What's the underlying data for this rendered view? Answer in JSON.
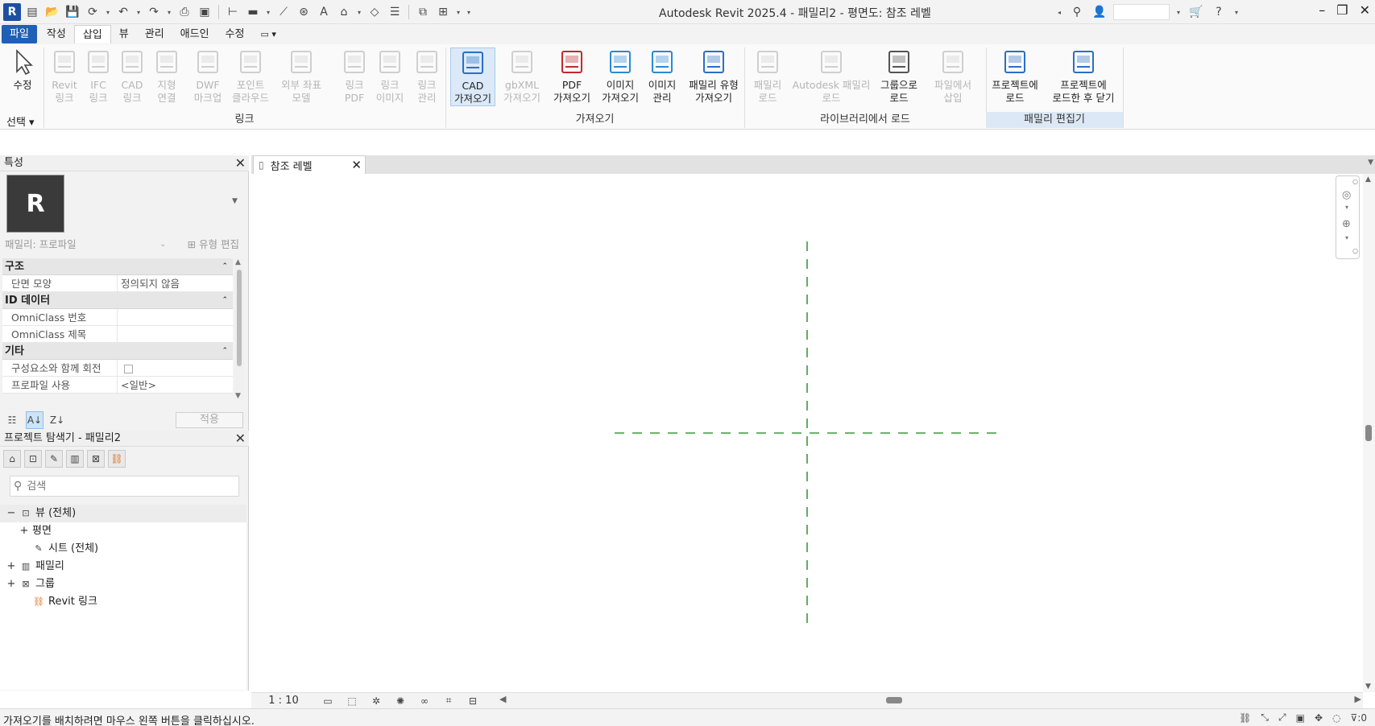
{
  "window": {
    "title": "Autodesk Revit 2025.4 - 패밀리2 - 평면도: 참조 레벨",
    "logo": "R"
  },
  "menu": {
    "tabs": [
      "파일",
      "작성",
      "삽입",
      "뷰",
      "관리",
      "애드인",
      "수정"
    ],
    "active_index": 2
  },
  "ribbon": {
    "select_label": "선택",
    "buttons": [
      {
        "id": "modify",
        "label": "수정",
        "icon": "cursor-arrow-icon",
        "disabled": false
      },
      {
        "id": "revit-link",
        "label": "Revit\n링크",
        "icon": "revit-link-icon",
        "disabled": true
      },
      {
        "id": "ifc-link",
        "label": "IFC\n링크",
        "icon": "ifc-link-icon",
        "disabled": true
      },
      {
        "id": "cad-link",
        "label": "CAD\n링크",
        "icon": "cad-link-icon",
        "disabled": true
      },
      {
        "id": "topo-link",
        "label": "지형\n연결",
        "icon": "topography-icon",
        "disabled": true
      },
      {
        "id": "dwf-markup",
        "label": "DWF\n마크업",
        "icon": "dwf-markup-icon",
        "disabled": true
      },
      {
        "id": "point-cloud",
        "label": "포인트\n클라우드",
        "icon": "point-cloud-icon",
        "disabled": true
      },
      {
        "id": "coord-model",
        "label": "외부 좌표\n모델",
        "icon": "coordination-model-icon",
        "disabled": true
      },
      {
        "id": "link-pdf",
        "label": "링크\nPDF",
        "icon": "link-pdf-icon",
        "disabled": true
      },
      {
        "id": "link-image",
        "label": "링크\n이미지",
        "icon": "link-image-icon",
        "disabled": true
      },
      {
        "id": "manage-links",
        "label": "링크\n관리",
        "icon": "manage-links-icon",
        "disabled": true
      },
      {
        "id": "import-cad",
        "label": "CAD\n가져오기",
        "icon": "import-cad-icon",
        "disabled": false,
        "selected": true
      },
      {
        "id": "import-gbxml",
        "label": "gbXML\n가져오기",
        "icon": "gbxml-icon",
        "disabled": true
      },
      {
        "id": "import-pdf",
        "label": "PDF\n가져오기",
        "icon": "import-pdf-icon",
        "disabled": false
      },
      {
        "id": "import-image",
        "label": "이미지\n가져오기",
        "icon": "import-image-icon",
        "disabled": false
      },
      {
        "id": "manage-images",
        "label": "이미지\n관리",
        "icon": "manage-images-icon",
        "disabled": false
      },
      {
        "id": "import-family-types",
        "label": "패밀리 유형\n가져오기",
        "icon": "family-types-icon",
        "disabled": false
      },
      {
        "id": "load-family",
        "label": "패밀리\n로드",
        "icon": "load-family-icon",
        "disabled": true
      },
      {
        "id": "load-autodesk-family",
        "label": "Autodesk 패밀리\n로드",
        "icon": "autodesk-family-icon",
        "disabled": true
      },
      {
        "id": "load-as-group",
        "label": "그룹으로\n로드",
        "icon": "load-group-icon",
        "disabled": false
      },
      {
        "id": "insert-from-file",
        "label": "파일에서\n삽입",
        "icon": "insert-file-icon",
        "disabled": true
      },
      {
        "id": "load-into-project",
        "label": "프로젝트에\n로드",
        "icon": "load-project-icon",
        "disabled": false
      },
      {
        "id": "load-into-project-close",
        "label": "프로젝트에\n로드한 후 닫기",
        "icon": "load-close-icon",
        "disabled": false
      }
    ],
    "panels": [
      "링크",
      "가져오기",
      "라이브러리에서 로드",
      "패밀리 편집기"
    ]
  },
  "properties": {
    "title": "특성",
    "thumb_letter": "R",
    "type_selector": "패밀리: 프로파일",
    "edit_type": "유형 편집",
    "groups": [
      {
        "name": "구조",
        "rows": [
          {
            "k": "단면 모양",
            "v": "정의되지 않음"
          }
        ]
      },
      {
        "name": "ID 데이터",
        "rows": [
          {
            "k": "OmniClass 번호",
            "v": ""
          },
          {
            "k": "OmniClass 제목",
            "v": ""
          }
        ]
      },
      {
        "name": "기타",
        "rows": [
          {
            "k": "구성요소와 함께 회전",
            "v": "",
            "checkbox": true
          },
          {
            "k": "프로파일 사용",
            "v": "<일반>"
          }
        ]
      }
    ],
    "apply": "적용"
  },
  "browser": {
    "title": "프로젝트 탐색기 - 패밀리2",
    "search_placeholder": "검색",
    "tree": [
      {
        "label": "뷰 (전체)",
        "toggle": "−",
        "level": 0,
        "icon": "views-icon",
        "highlight": true
      },
      {
        "label": "평면",
        "toggle": "+",
        "level": 1,
        "icon": ""
      },
      {
        "label": "시트 (전체)",
        "toggle": "",
        "level": 1,
        "icon": "sheet-icon"
      },
      {
        "label": "패밀리",
        "toggle": "+",
        "level": 0,
        "icon": "family-icon"
      },
      {
        "label": "그룹",
        "toggle": "+",
        "level": 0,
        "icon": "group-icon"
      },
      {
        "label": "Revit 링크",
        "toggle": "",
        "level": 1,
        "icon": "revit-link-tree-icon"
      }
    ]
  },
  "view": {
    "tab_label": "참조 레벨",
    "scale": "1 : 10",
    "ref_plane_color": "#3a9a3a"
  },
  "status": {
    "text": "가져오기를 배치하려면 마우스 왼쪽 버튼을 클릭하십시오.",
    "filter_count": ":0"
  }
}
